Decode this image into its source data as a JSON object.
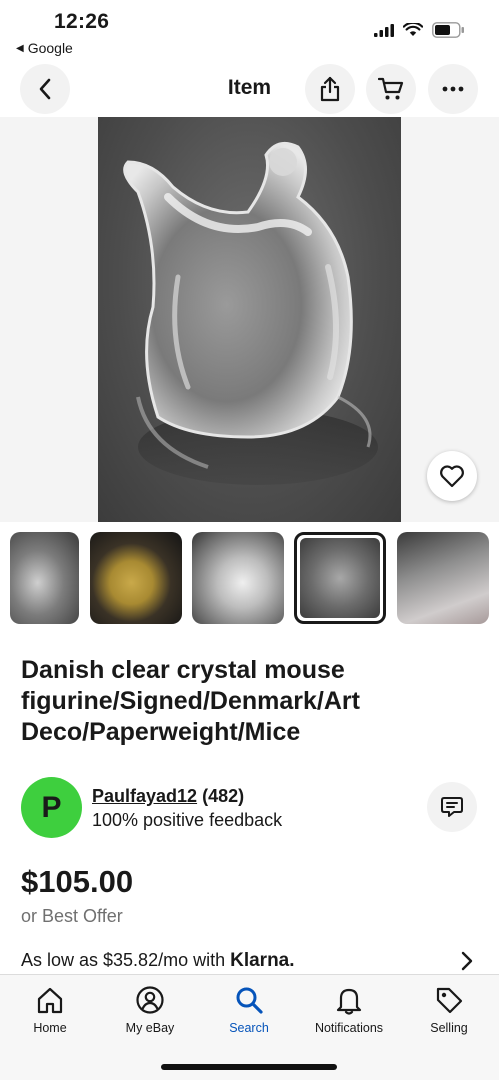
{
  "status_bar": {
    "time": "12:26",
    "back_app": "Google",
    "back_icon": "left-triangle-icon",
    "signal_icon": "cell-signal-icon",
    "wifi_icon": "wifi-icon",
    "battery_icon": "battery-icon"
  },
  "header": {
    "title": "Item",
    "back_icon": "chevron-left-icon",
    "share_icon": "share-icon",
    "cart_icon": "cart-icon",
    "more_icon": "ellipsis-icon"
  },
  "hero": {
    "image_subject": "clear crystal mouse figurine on dark background",
    "favorite_icon": "heart-icon"
  },
  "thumbnails": {
    "count": 5,
    "selected_index": 3
  },
  "item": {
    "title": "Danish clear crystal mouse figurine/Signed/Denmark/Art Deco/Paperweight/Mice"
  },
  "seller": {
    "avatar_letter": "P",
    "avatar_color": "#3ecf3e",
    "name": "Paulfayad12",
    "rating": "(482)",
    "feedback": "100% positive feedback",
    "message_icon": "message-icon"
  },
  "price": {
    "amount": "$105.00",
    "offer": "or Best Offer",
    "financing": "As low as $35.82/mo with",
    "financing_brand": "Klarna.",
    "chevron_icon": "chevron-right-icon"
  },
  "tabbar": {
    "active_color": "#0654ba",
    "items": [
      {
        "label": "Home",
        "icon": "home-icon"
      },
      {
        "label": "My eBay",
        "icon": "user-circle-icon"
      },
      {
        "label": "Search",
        "icon": "search-icon"
      },
      {
        "label": "Notifications",
        "icon": "bell-icon"
      },
      {
        "label": "Selling",
        "icon": "tag-icon"
      }
    ]
  }
}
